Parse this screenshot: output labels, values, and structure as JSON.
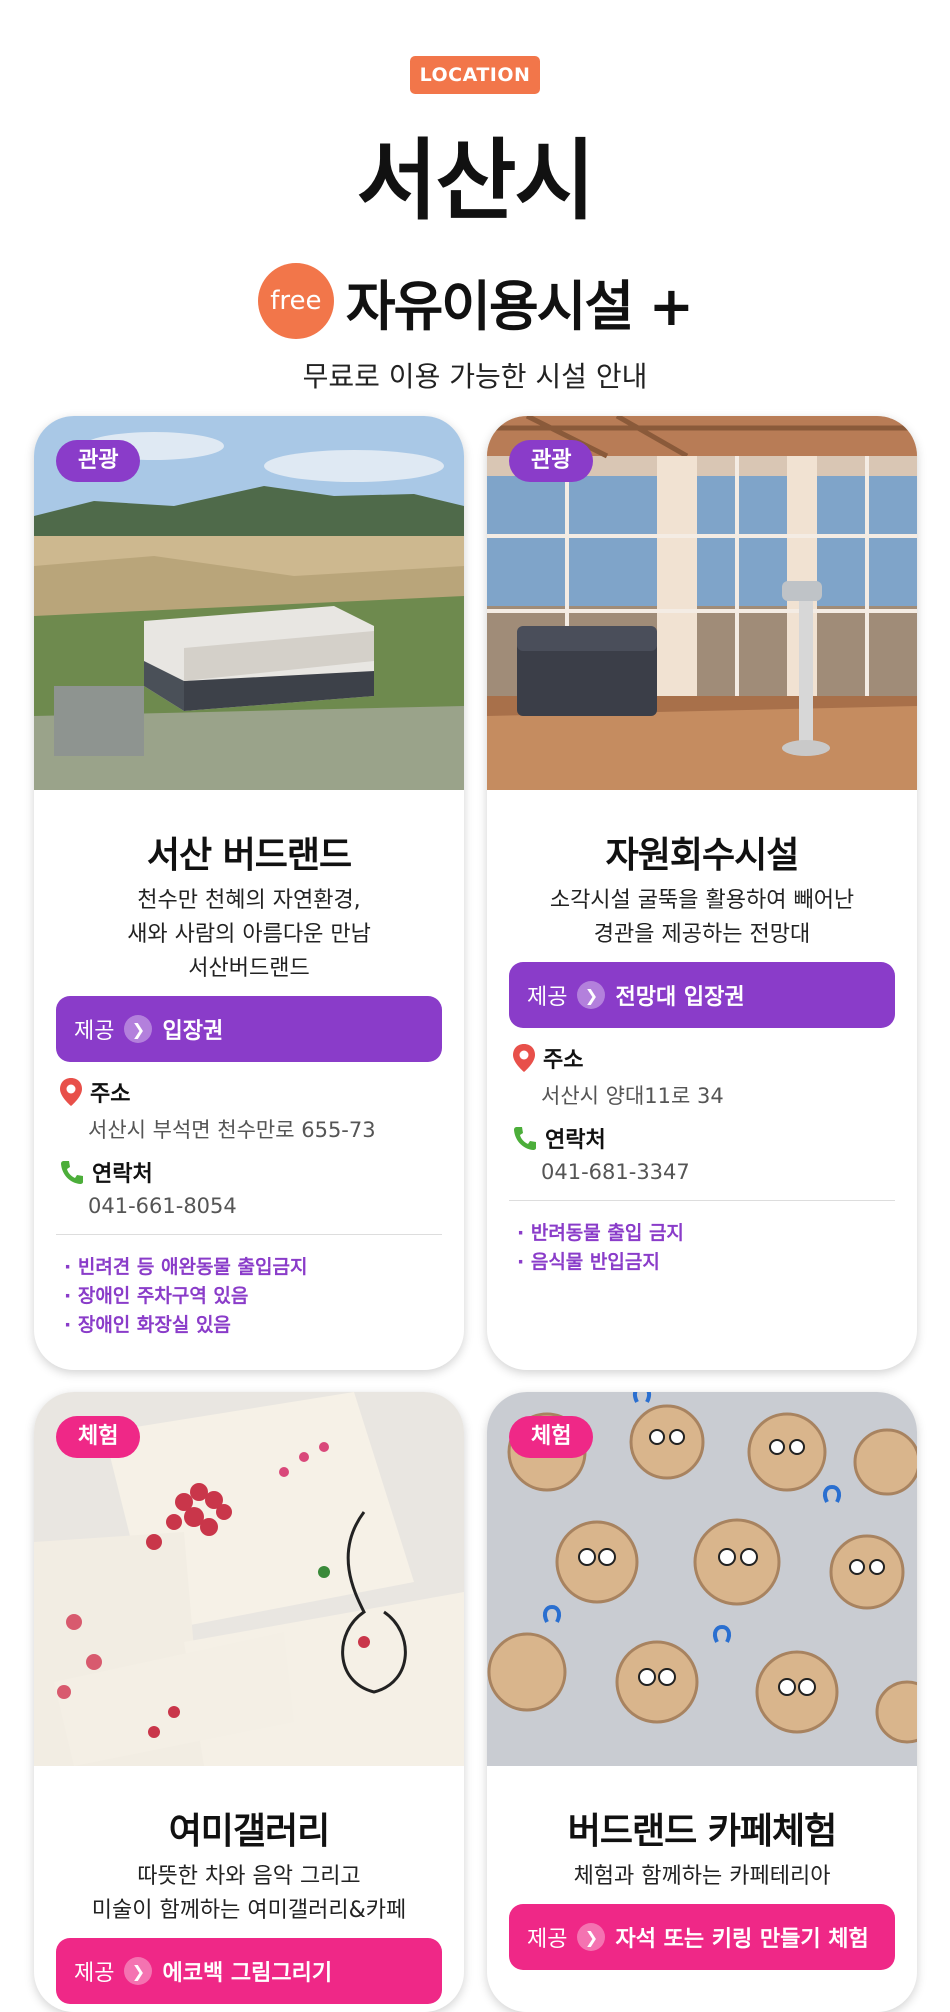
{
  "header": {
    "badge": "LOCATION",
    "city": "서산시",
    "free_label": "free",
    "section_title": "자유이용시설 +",
    "subtitle": "무료로 이용 가능한 시설 안내"
  },
  "cards": [
    {
      "category": "관광",
      "title": "서산 버드랜드",
      "desc": [
        "천수만 천혜의 자연환경,",
        "새와 사람의 아름다운 만남",
        "서산버드랜드"
      ],
      "offer_label": "제공",
      "offer_value": "입장권",
      "address_label": "주소",
      "address": "서산시 부석면 천수만로 655-73",
      "contact_label": "연락처",
      "contact": "041-661-8054",
      "notes": [
        "· 빈려견 등 애완동물 출입금지",
        "· 장애인 주차구역 있음",
        "· 장애인 화장실 있음"
      ]
    },
    {
      "category": "관광",
      "title": "자원회수시설",
      "desc": [
        "소각시설 굴뚝을 활용하여 빼어난",
        "경관을 제공하는 전망대"
      ],
      "offer_label": "제공",
      "offer_value": "전망대 입장권",
      "address_label": "주소",
      "address": "서산시 양대11로 34",
      "contact_label": "연락처",
      "contact": "041-681-3347",
      "notes": [
        "· 반려동물 출입 금지",
        "· 음식물 반입금지"
      ]
    },
    {
      "category": "체험",
      "title": "여미갤러리",
      "desc": [
        "따뜻한 차와 음악 그리고",
        "미술이 함께하는 여미갤러리&카페"
      ],
      "offer_label": "제공",
      "offer_value": "에코백 그림그리기"
    },
    {
      "category": "체험",
      "title": "버드랜드 카페체험",
      "desc": [
        "체험과 함께하는 카페테리아"
      ],
      "offer_label": "제공",
      "offer_value": "자석 또는 키링 만들기 체험"
    }
  ],
  "colors": {
    "orange": "#f2764a",
    "purple": "#8a3cc9",
    "pink": "#ef2887"
  }
}
